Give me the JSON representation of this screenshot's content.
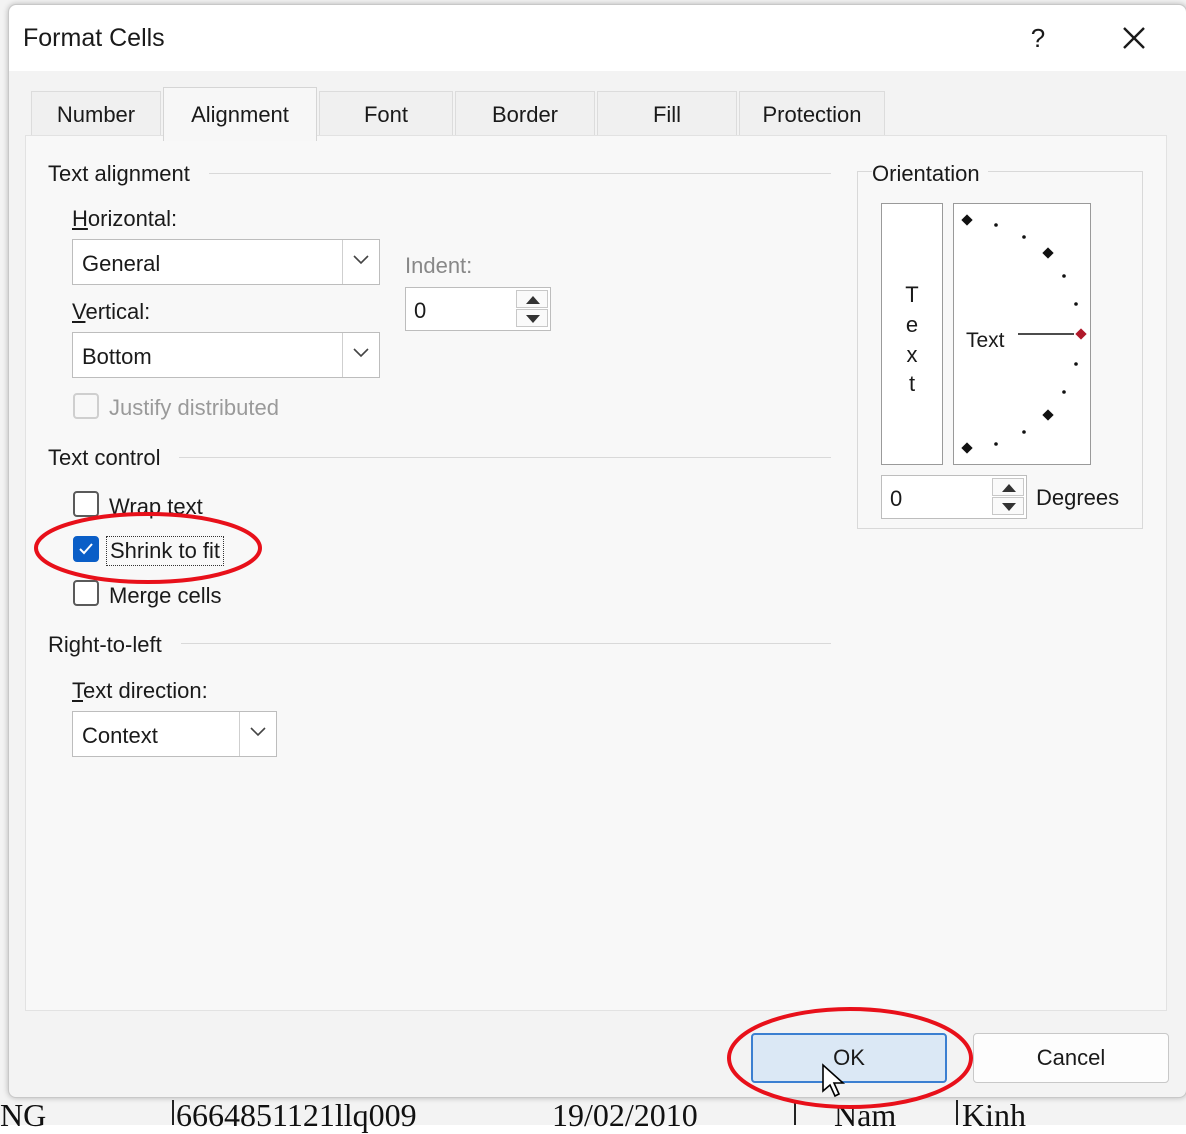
{
  "background_sheet": {
    "cells": [
      "NG",
      "6664851121llq009",
      "19/02/2010",
      "Nam",
      "Kinh"
    ]
  },
  "dialog": {
    "title": "Format Cells",
    "help_label": "?",
    "close_icon": "close-icon"
  },
  "tabs": [
    {
      "label": "Number",
      "active": false
    },
    {
      "label": "Alignment",
      "active": true
    },
    {
      "label": "Font",
      "active": false
    },
    {
      "label": "Border",
      "active": false
    },
    {
      "label": "Fill",
      "active": false
    },
    {
      "label": "Protection",
      "active": false
    }
  ],
  "text_alignment": {
    "section_label": "Text alignment",
    "horizontal_label": "Horizontal:",
    "horizontal_value": "General",
    "vertical_label": "Vertical:",
    "vertical_value": "Bottom",
    "indent_label": "Indent:",
    "indent_value": "0",
    "justify_distributed_label": "Justify distributed",
    "justify_distributed_checked": false
  },
  "text_control": {
    "section_label": "Text control",
    "wrap_text_label": "Wrap text",
    "wrap_text_checked": false,
    "shrink_to_fit_label": "Shrink to fit",
    "shrink_to_fit_checked": true,
    "merge_cells_label": "Merge cells",
    "merge_cells_checked": false
  },
  "right_to_left": {
    "section_label": "Right-to-left",
    "text_direction_label": "Text direction:",
    "text_direction_value": "Context"
  },
  "orientation": {
    "section_label": "Orientation",
    "vertical_text_chars": [
      "T",
      "e",
      "x",
      "t"
    ],
    "dial_text": "Text",
    "degrees_value": "0",
    "degrees_label": "Degrees"
  },
  "buttons": {
    "ok": "OK",
    "cancel": "Cancel"
  },
  "annotations": {
    "highlight_color": "#e8101a"
  },
  "colors": {
    "accent": "#0a5ec7",
    "dial_marker": "#b0182a"
  }
}
